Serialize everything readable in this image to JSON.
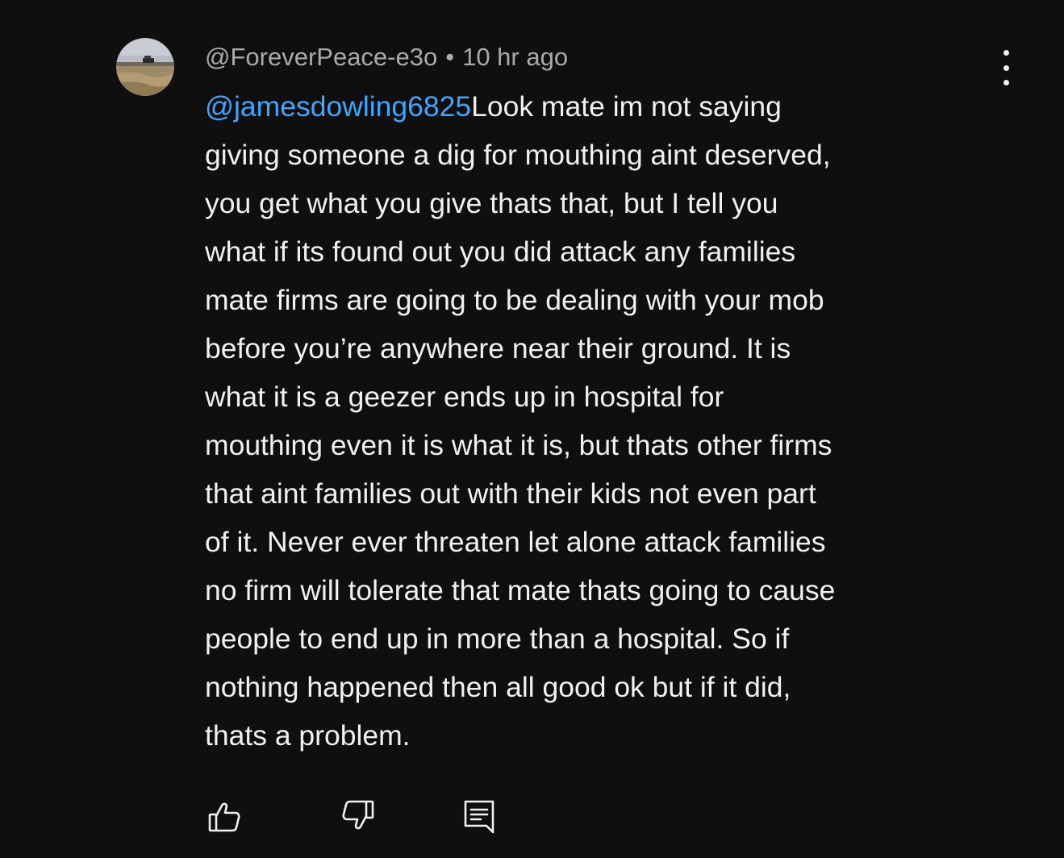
{
  "comment": {
    "author": "@ForeverPeace-e3o",
    "separator": "•",
    "timestamp": "10 hr ago",
    "mention": "@jamesdowling6825",
    "text": "Look mate im not saying\ngiving someone a dig for mouthing aint deserved,\nyou get what you give thats that, but I tell you\nwhat if its found out you did attack any families\nmate firms are going to be dealing with your mob\nbefore you’re anywhere near their ground. It is\nwhat it is a geezer ends up in hospital for\nmouthing even it is what it is, but thats other firms\nthat aint families out with their kids not even part\nof it. Never ever threaten let alone attack families\nno firm will tolerate that mate thats going to cause\npeople to end up in more than a hospital. So if\nnothing happened then all good ok but if it did,\nthats a problem."
  },
  "icons": {
    "menu": "more-vert-icon",
    "like": "thumbs-up-icon",
    "dislike": "thumbs-down-icon",
    "reply": "reply-comment-icon"
  },
  "colors": {
    "background": "#0f0f0f",
    "text": "#f1f1f1",
    "meta": "#aaaaaa",
    "mention": "#3ea6ff"
  }
}
